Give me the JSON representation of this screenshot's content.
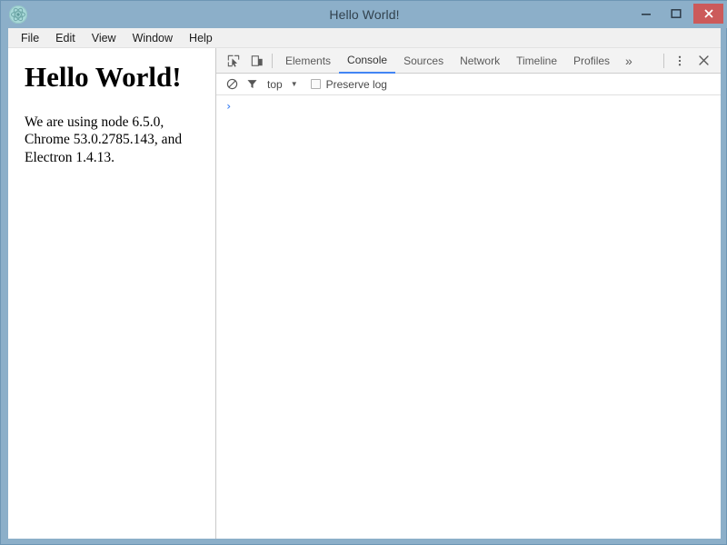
{
  "window": {
    "title": "Hello World!",
    "app_icon": "electron-atom-icon",
    "controls": {
      "minimize": "minimize-icon",
      "maximize": "maximize-icon",
      "close": "close-icon"
    },
    "colors": {
      "titlebar": "#8cafc9",
      "close_button": "#cc5a5a",
      "menubar": "#f0f0f0",
      "accent": "#4285f4"
    }
  },
  "menubar": {
    "items": [
      {
        "label": "File"
      },
      {
        "label": "Edit"
      },
      {
        "label": "View"
      },
      {
        "label": "Window"
      },
      {
        "label": "Help"
      }
    ]
  },
  "page": {
    "heading": "Hello World!",
    "paragraph": "We are using node 6.5.0, Chrome 53.0.2785.143, and Electron 1.4.13."
  },
  "devtools": {
    "toolbar": {
      "inspect_icon": "inspect-element-icon",
      "device_icon": "device-toolbar-icon",
      "overflow_label": "»",
      "more_icon": "more-vertical-icon",
      "close_icon": "close-devtools-icon"
    },
    "tabs": [
      {
        "label": "Elements",
        "active": false
      },
      {
        "label": "Console",
        "active": true
      },
      {
        "label": "Sources",
        "active": false
      },
      {
        "label": "Network",
        "active": false
      },
      {
        "label": "Timeline",
        "active": false
      },
      {
        "label": "Profiles",
        "active": false
      }
    ],
    "console_toolbar": {
      "clear_icon": "clear-console-icon",
      "filter_icon": "filter-icon",
      "context": "top",
      "context_caret": "▼",
      "preserve_log_label": "Preserve log",
      "preserve_log_checked": false
    },
    "console": {
      "prompt_caret": "›",
      "prompt_value": "",
      "messages": []
    }
  }
}
